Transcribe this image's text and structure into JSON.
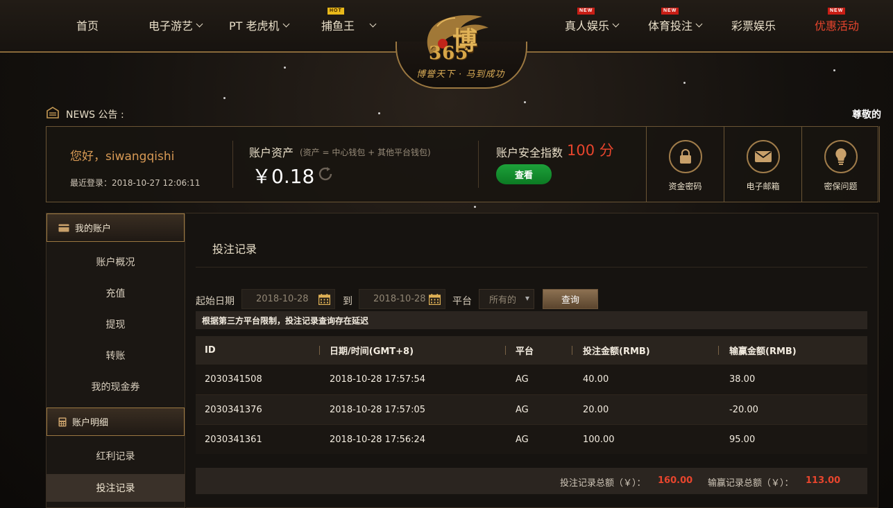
{
  "nav": {
    "home": "首页",
    "electronic": "电子游艺",
    "pt": "PT 老虎机",
    "fishing": "捕鱼王",
    "fishing_badge": "HOT",
    "live": "真人娱乐",
    "live_badge": "NEW",
    "sports": "体育投注",
    "sports_badge": "NEW",
    "lottery": "彩票娱乐",
    "promo": "优惠活动",
    "promo_badge": "NEW"
  },
  "logo": {
    "numerals": "365",
    "character": "博",
    "slogan": "博誉天下 · 马到成功"
  },
  "news": {
    "label": "NEWS 公告 :",
    "marquee": "尊敬的"
  },
  "account": {
    "greeting": "您好，siwangqishi",
    "last_login": "最近登录：2018-10-27 12:06:11",
    "assets_title": "账户资产",
    "assets_note": "(资产 = 中心钱包 + 其他平台钱包)",
    "assets_value": "￥0.18",
    "security_title": "账户安全指数",
    "security_score": "100 分",
    "view_button": "查看",
    "tiles": [
      "资金密码",
      "电子邮箱",
      "密保问题"
    ]
  },
  "sidebar": {
    "section1": "我的账户",
    "section1_items": [
      "账户概况",
      "充值",
      "提现",
      "转账",
      "我的现金券"
    ],
    "section2": "账户明细",
    "section2_items": [
      "红利记录",
      "投注记录"
    ]
  },
  "main": {
    "title": "投注记录",
    "filter": {
      "start_label": "起始日期",
      "start_value": "2018-10-28",
      "to_label": "到",
      "end_value": "2018-10-28",
      "platform_label": "平台",
      "platform_value": "所有的",
      "query_button": "查询"
    },
    "notice": "根据第三方平台限制，投注记录查询存在延迟",
    "table": {
      "headers": [
        "ID",
        "日期/时间(GMT+8)",
        "平台",
        "投注金额(RMB)",
        "输赢金额(RMB)"
      ],
      "rows": [
        [
          "2030341508",
          "2018-10-28 17:57:54",
          "AG",
          "40.00",
          "38.00"
        ],
        [
          "2030341376",
          "2018-10-28 17:57:05",
          "AG",
          "20.00",
          "-20.00"
        ],
        [
          "2030341361",
          "2018-10-28 17:56:24",
          "AG",
          "100.00",
          "95.00"
        ]
      ]
    },
    "totals": {
      "bet_label": "投注记录总额（￥）：",
      "bet_value": "160.00",
      "win_label": "输赢记录总额（￥）：",
      "win_value": "113.00"
    }
  },
  "colors": {
    "accent_gold": "#9b7841",
    "promo_red": "#e8452d",
    "view_green": "#1da13a"
  }
}
